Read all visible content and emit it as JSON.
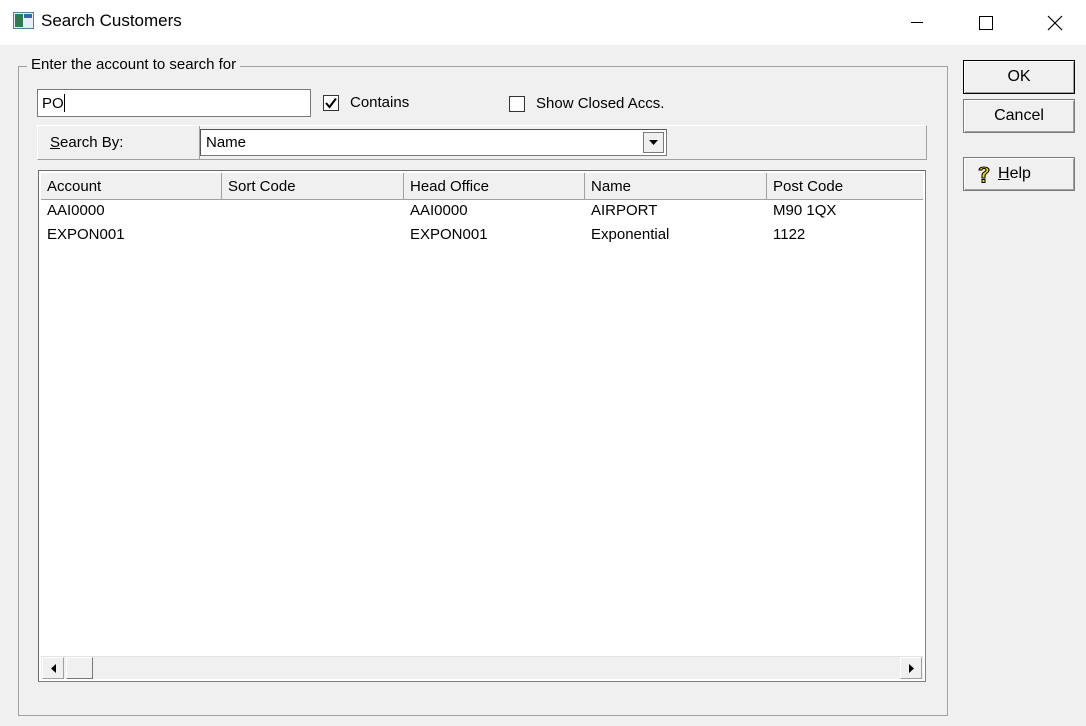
{
  "window": {
    "title": "Search Customers"
  },
  "search_group": {
    "legend": "Enter the account to search for",
    "search_value": "PO",
    "contains_label": "Contains",
    "contains_checked": true,
    "show_closed_label": "Show Closed Accs.",
    "show_closed_checked": false
  },
  "search_by": {
    "label_first": "S",
    "label_rest": "earch By:",
    "selected": "Name"
  },
  "list": {
    "columns": [
      "Account",
      "Sort Code",
      "Head Office",
      "Name",
      "Post Code"
    ],
    "rows": [
      [
        "AAI0000",
        "",
        "AAI0000",
        "AIRPORT",
        "M90 1QX"
      ],
      [
        "EXPON001",
        "",
        "EXPON001",
        "Exponential",
        "1122"
      ]
    ]
  },
  "buttons": {
    "ok": "OK",
    "cancel": "Cancel",
    "help_first": "H",
    "help_rest": "elp"
  }
}
